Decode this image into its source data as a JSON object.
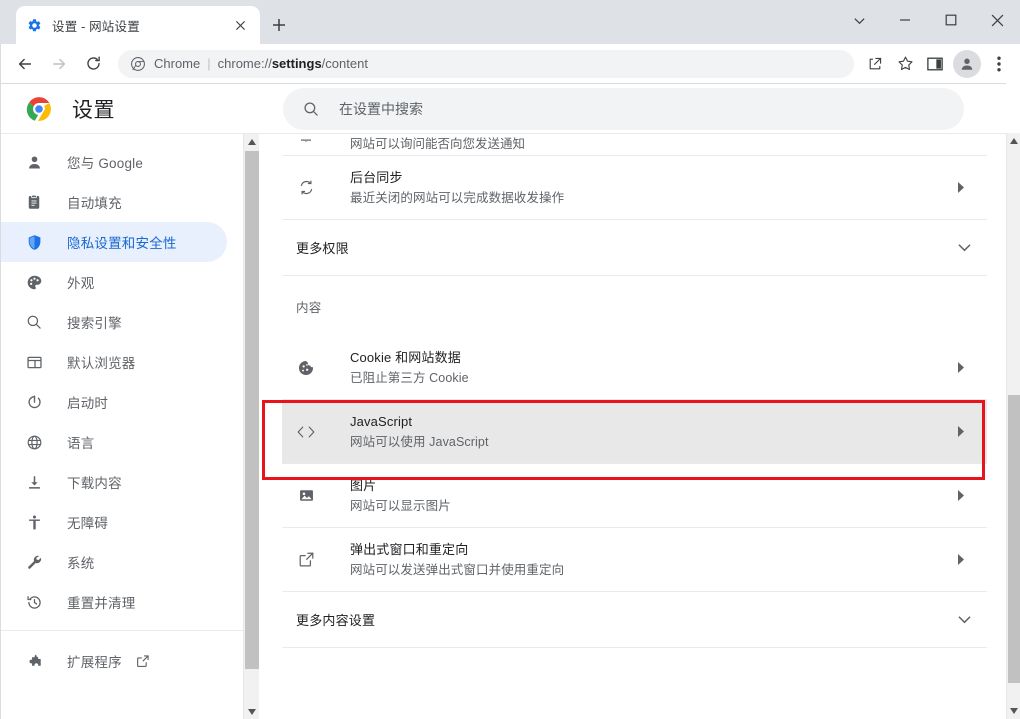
{
  "window": {
    "controls": [
      {
        "name": "tab-search-chevron",
        "glyph": "chevron-down"
      },
      {
        "name": "minimize",
        "glyph": "minimize"
      },
      {
        "name": "maximize",
        "glyph": "maximize"
      },
      {
        "name": "close",
        "glyph": "close"
      }
    ]
  },
  "tab": {
    "title": "设置 - 网站设置",
    "favicon": "gear-icon",
    "close_label": "×",
    "newtab_label": "+"
  },
  "toolbar": {
    "back": "back-arrow",
    "forward": "forward-arrow",
    "reload": "reload-icon",
    "omnibox": {
      "scheme_label": "Chrome",
      "separator": "|",
      "url_prefix": "chrome://",
      "url_bold": "settings",
      "url_suffix": "/content",
      "full_url": "chrome://settings/content"
    },
    "actions": [
      "share-icon",
      "bookmark-star-icon",
      "side-panel-icon",
      "profile-avatar",
      "more-menu-icon"
    ]
  },
  "header": {
    "logo": "chrome-logo",
    "title": "设置"
  },
  "search": {
    "icon": "search-icon",
    "placeholder": "在设置中搜索",
    "value": ""
  },
  "sidebar": {
    "group1": [
      {
        "label": "您与 Google",
        "icon": "person-icon",
        "selected": false
      },
      {
        "label": "自动填充",
        "icon": "clipboard-icon",
        "selected": false
      },
      {
        "label": "隐私设置和安全性",
        "icon": "shield-icon",
        "selected": true
      },
      {
        "label": "外观",
        "icon": "palette-icon",
        "selected": false
      },
      {
        "label": "搜索引擎",
        "icon": "search-icon",
        "selected": false
      },
      {
        "label": "默认浏览器",
        "icon": "browser-window-icon",
        "selected": false
      },
      {
        "label": "启动时",
        "icon": "power-icon",
        "selected": false
      },
      {
        "label": "语言",
        "icon": "globe-icon",
        "selected": false
      },
      {
        "label": "下载内容",
        "icon": "download-icon",
        "selected": false
      },
      {
        "label": "无障碍",
        "icon": "accessibility-icon",
        "selected": false
      },
      {
        "label": "系统",
        "icon": "wrench-icon",
        "selected": false
      },
      {
        "label": "重置并清理",
        "icon": "history-restore-icon",
        "selected": false
      }
    ],
    "group2": [
      {
        "label": "扩展程序",
        "icon": "puzzle-icon",
        "external": true
      }
    ]
  },
  "content": {
    "partial_top_row": {
      "subtitle": "网站可以询问能否向您发送通知",
      "icon": "notification-icon"
    },
    "rows_permissions": [
      {
        "title": "后台同步",
        "subtitle": "最近关闭的网站可以完成数据收发操作",
        "icon": "sync-icon",
        "arrow": "chevron-right",
        "highlighted": false
      }
    ],
    "more_permissions": {
      "label": "更多权限",
      "arrow": "chevron-down"
    },
    "section_heading": "内容",
    "rows_content": [
      {
        "title": "Cookie 和网站数据",
        "subtitle": "已阻止第三方 Cookie",
        "icon": "cookie-icon",
        "arrow": "chevron-right",
        "highlighted": false
      },
      {
        "title": "JavaScript",
        "subtitle": "网站可以使用 JavaScript",
        "icon": "code-brackets-icon",
        "arrow": "chevron-right",
        "highlighted": true
      },
      {
        "title": "图片",
        "subtitle": "网站可以显示图片",
        "icon": "image-icon",
        "arrow": "chevron-right",
        "highlighted": false
      },
      {
        "title": "弹出式窗口和重定向",
        "subtitle": "网站可以发送弹出式窗口并使用重定向",
        "icon": "external-link-icon",
        "arrow": "chevron-right",
        "highlighted": false
      }
    ],
    "more_content": {
      "label": "更多内容设置",
      "arrow": "chevron-down"
    }
  },
  "annotation": {
    "color": "#e8141b",
    "target": "JavaScript"
  },
  "colors": {
    "accent": "#1a73e8",
    "selected_pill": "#e8f0fe",
    "highlight_row": "#e8e8e8",
    "tabstrip": "#dee1e6",
    "divider": "#e8eaed"
  }
}
